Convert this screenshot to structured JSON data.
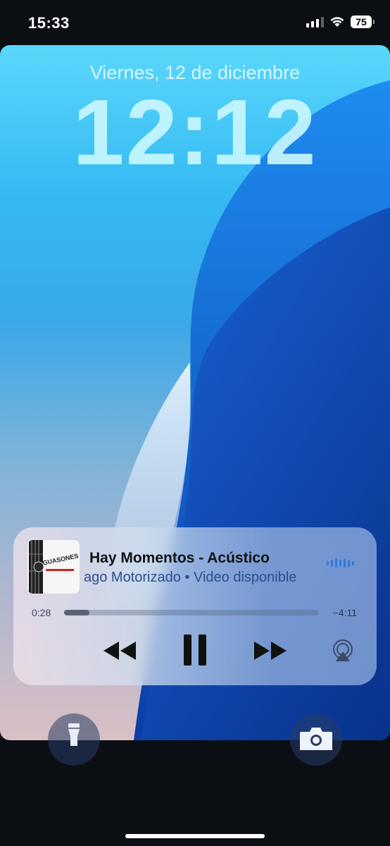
{
  "status_bar": {
    "time": "15:33",
    "battery": "75",
    "icons": [
      "cellular-signal-icon",
      "wifi-icon",
      "battery-icon"
    ]
  },
  "lock_screen": {
    "date": "Viernes, 12 de diciembre",
    "clock": "12:12"
  },
  "now_playing": {
    "title": "Hay Momentos - Acústico",
    "subtitle": "ago Motorizado • Video disponible",
    "elapsed": "0:28",
    "remaining": "−4:11",
    "progress": 0.1,
    "artwork_text": "GUASONES",
    "controls": [
      "rewind-icon",
      "pause-icon",
      "fast-forward-icon",
      "airplay-icon"
    ],
    "accent_color": "#2f7be0"
  },
  "quick_actions": [
    "flashlight-icon",
    "camera-icon"
  ]
}
